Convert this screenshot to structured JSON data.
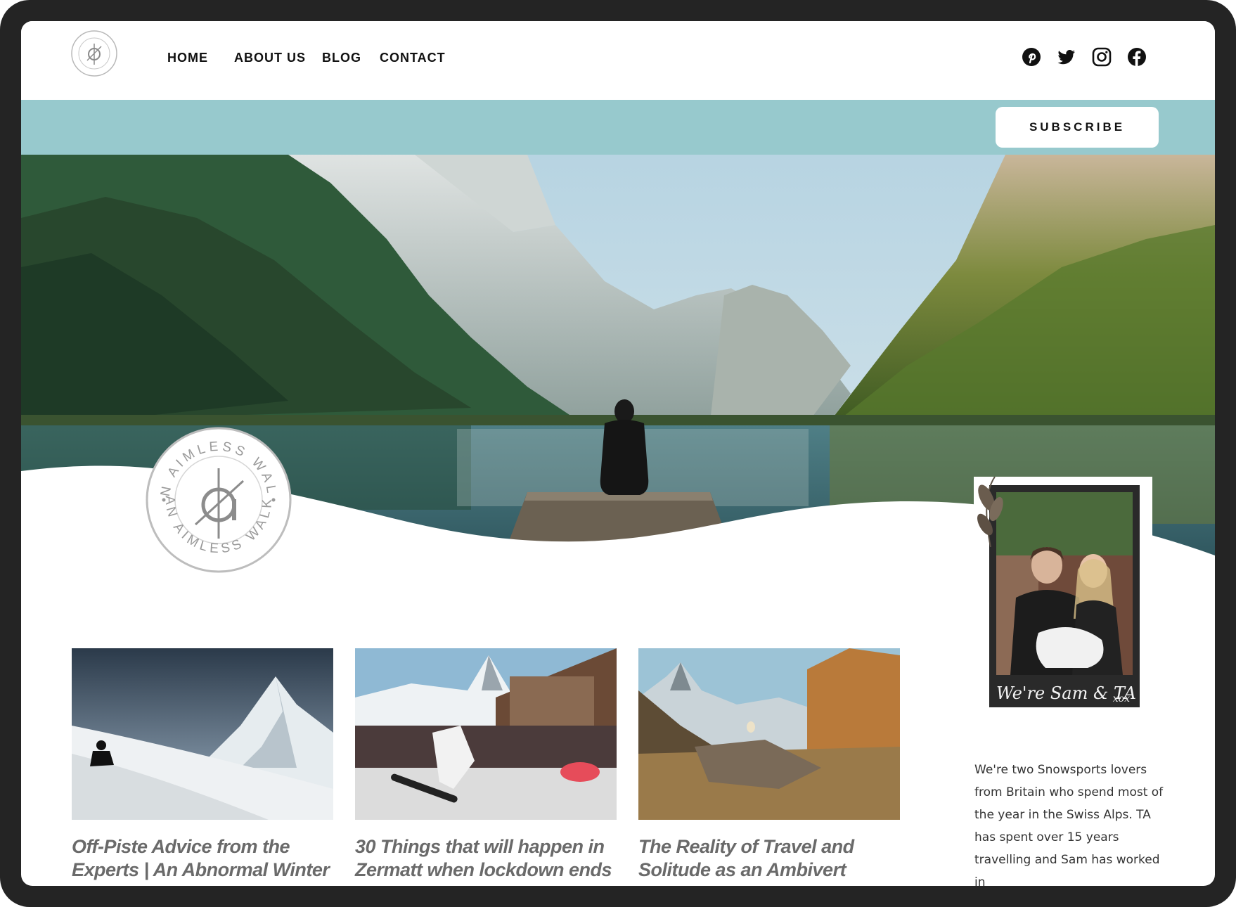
{
  "site": {
    "badge_text_top": "AN AIMLESS WALK",
    "badge_text_bottom": "AN AIMLESS WALK"
  },
  "nav": {
    "items": [
      {
        "label": "HOME"
      },
      {
        "label": "ABOUT US"
      },
      {
        "label": "BLOG"
      },
      {
        "label": "CONTACT"
      }
    ]
  },
  "social": {
    "icons": [
      "pinterest-icon",
      "twitter-icon",
      "instagram-icon",
      "facebook-icon"
    ]
  },
  "subscribe": {
    "label": "SUBSCRIBE"
  },
  "polaroid": {
    "caption": "We're Sam & TA",
    "signoff": "xox"
  },
  "about": {
    "text": "We're two Snowsports lovers from Britain who spend most of the year in the Swiss Alps. TA has spent over 15 years travelling and Sam has worked in"
  },
  "posts": [
    {
      "title": "Off-Piste Advice from the Experts | An Abnormal Winter"
    },
    {
      "title": "30 Things that will happen in Zermatt when lockdown ends"
    },
    {
      "title": "The Reality of Travel and Solitude as an Ambivert"
    }
  ],
  "colors": {
    "accent_teal": "#97c9cd",
    "frame": "#242424",
    "nav_text": "#111111",
    "post_title": "#6a6a6a"
  }
}
